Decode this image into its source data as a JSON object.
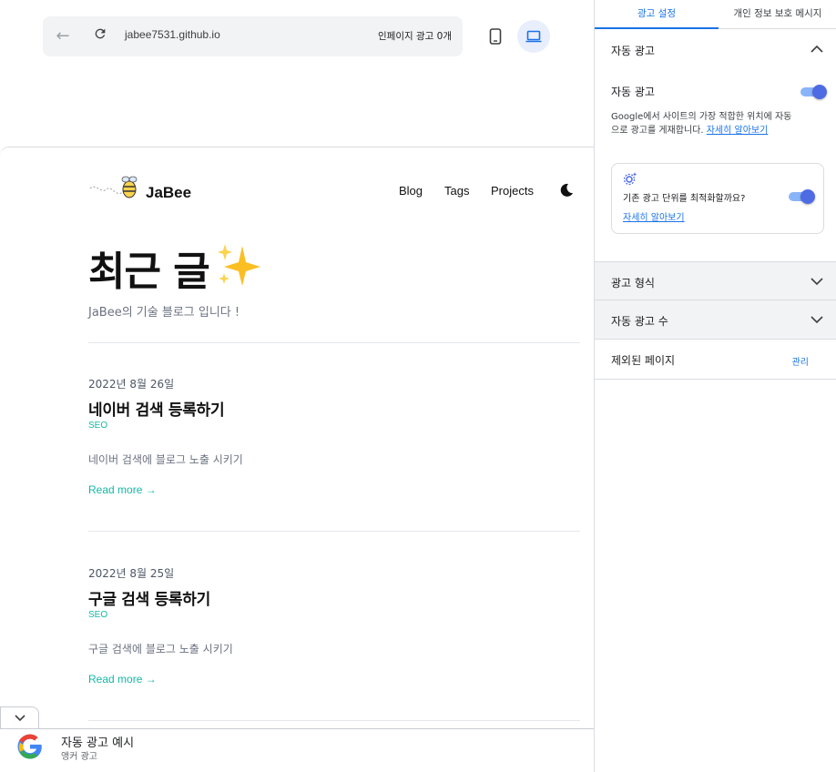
{
  "browser": {
    "url": "jabee7531.github.io",
    "inpage_ad_count": "인페이지 광고 0개"
  },
  "site": {
    "brand": "JaBee",
    "nav": [
      "Blog",
      "Tags",
      "Projects"
    ],
    "hero_title": "최근 글",
    "hero_emoji": "✨",
    "hero_subtitle": "JaBee의 기술 블로그 입니다 !",
    "posts": [
      {
        "date": "2022년 8월 26일",
        "title": "네이버 검색 등록하기",
        "tag": "SEO",
        "summary": "네이버 검색에 블로그 노출 시키기",
        "more": "Read more →"
      },
      {
        "date": "2022년 8월 25일",
        "title": "구글 검색 등록하기",
        "tag": "SEO",
        "summary": "구글 검색에 블로그 노출 시키기",
        "more": "Read more →"
      }
    ]
  },
  "anchor_ad": {
    "title": "자동 광고 예시",
    "subtitle": "앵커 광고"
  },
  "panel": {
    "tabs": [
      "광고 설정",
      "개인 정보 보호 메시지"
    ],
    "active_tab": "광고 설정",
    "auto_ads_section": "자동 광고",
    "auto_ads_label": "자동 광고",
    "auto_ads_enabled": true,
    "auto_ads_desc": "Google에서 사이트의 가장 적합한 위치에 자동으로 광고를 게재합니다.",
    "learn_more": "자세히 알아보기",
    "optimize_question": "기존 광고 단위를 최적화할까요?",
    "optimize_enabled": true,
    "optimize_learn_more": "자세히 알아보기",
    "ad_formats": "광고 형식",
    "ad_load": "자동 광고 수",
    "excluded_pages": "제외된 페이지",
    "manage": "관리"
  },
  "colors": {
    "accent_blue": "#1a73e8",
    "teal_link": "#14b8a6",
    "toggle_on": "#4e6be3"
  }
}
